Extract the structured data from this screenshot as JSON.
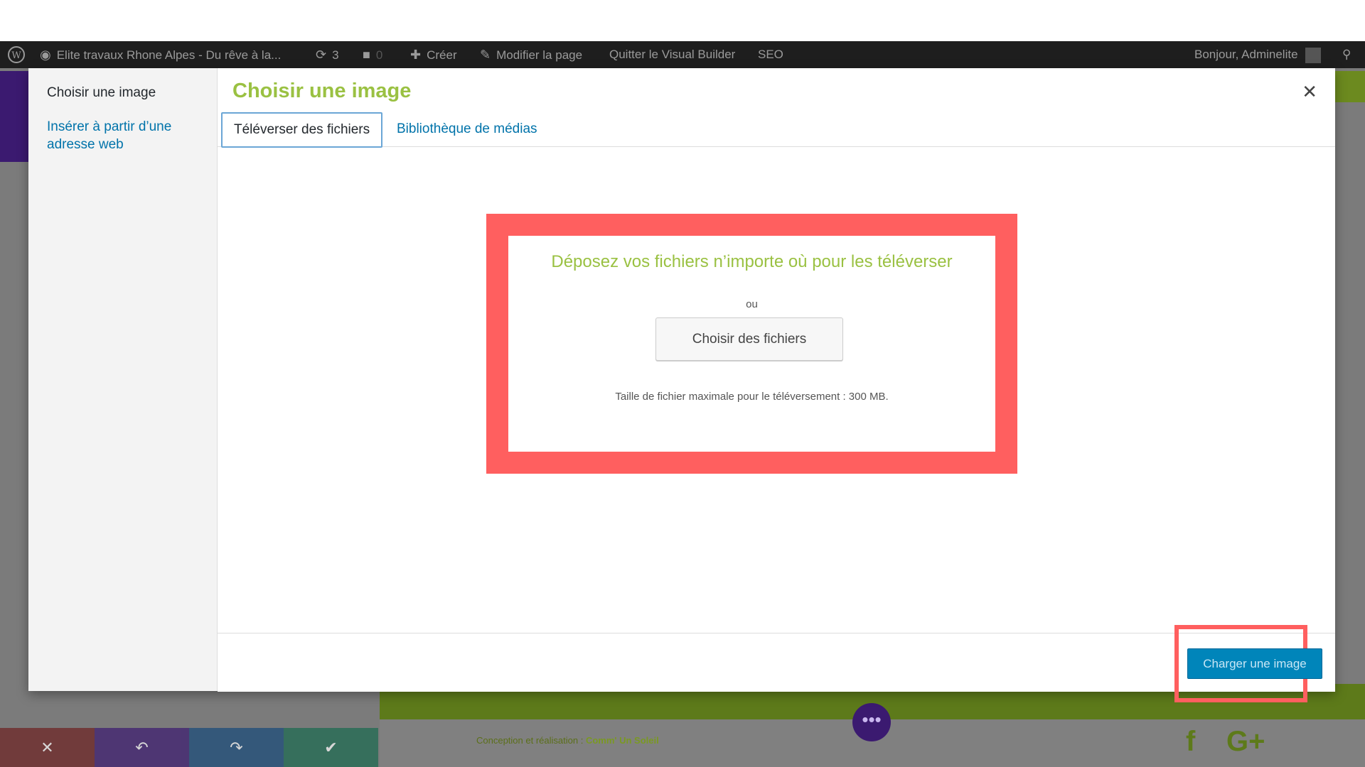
{
  "admin_bar": {
    "site_name": "Elite travaux Rhone Alpes - Du rêve à la...",
    "updates_count": "3",
    "comments_count": "0",
    "create_label": "Créer",
    "edit_page_label": "Modifier la page",
    "quit_builder_label": "Quitter le Visual Builder",
    "seo_label": "SEO",
    "greeting": "Bonjour, Adminelite"
  },
  "modal": {
    "sidebar_title": "Choisir une image",
    "sidebar_link": "Insérer à partir d’une adresse web",
    "title": "Choisir une image",
    "close_symbol": "✕",
    "tabs": [
      {
        "label": "Téléverser des fichiers",
        "active": true
      },
      {
        "label": "Bibliothèque de médias",
        "active": false
      }
    ],
    "dropzone": {
      "instructions": "Déposez vos fichiers n’importe où pour les téléverser",
      "or": "ou",
      "choose_button": "Choisir des fichiers",
      "max_size": "Taille de fichier maximale pour le téléversement : 300 MB."
    },
    "primary_button": "Charger une image"
  },
  "footer": {
    "credit_prefix": "Conception et réalisation :",
    "credit_name": "Comm' Un Soleil",
    "dots": "•••",
    "facebook": "f",
    "googleplus": "G+"
  },
  "bottom_bar": {
    "cancel": "✕",
    "undo": "↶",
    "redo": "↷",
    "confirm": "✔"
  },
  "colors": {
    "accent_green": "#9ac142",
    "link_blue": "#0073aa",
    "primary_button": "#0085ba",
    "highlight_red": "#ff5f5f"
  }
}
